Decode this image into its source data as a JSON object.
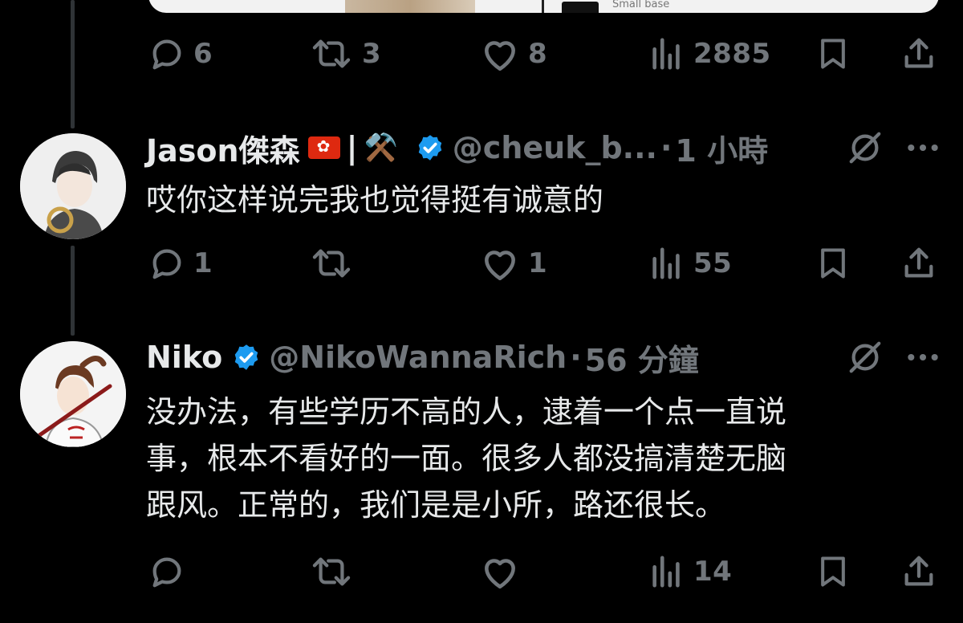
{
  "card": {
    "caption": "Small base"
  },
  "tweets": [
    {
      "actions": {
        "replies": "6",
        "reposts": "3",
        "likes": "8",
        "views": "2885"
      }
    },
    {
      "display_name": "Jason傑森",
      "separator": "|",
      "tools_emoji": "⚒️",
      "handle": "@cheuk_b...",
      "dot": "·",
      "time": "1 小時",
      "text": "哎你这样说完我也觉得挺有诚意的",
      "actions": {
        "replies": "1",
        "reposts": "",
        "likes": "1",
        "views": "55"
      }
    },
    {
      "display_name": "Niko",
      "handle": "@NikoWannaRich",
      "dot": "·",
      "time": "56 分鐘",
      "text_lines": [
        "没办法，有些学历不高的人，逮着一个点一直说",
        "事，根本不看好的一面。很多人都没搞清楚无脑",
        "跟风。正常的，我们是是小所，路还很长。"
      ],
      "actions": {
        "replies": "",
        "reposts": "",
        "likes": "",
        "views": "14"
      }
    }
  ],
  "colors": {
    "background": "#000000",
    "text": "#e7e9ea",
    "muted": "#71767b",
    "verified": "#1d9bf0",
    "thread": "#2f3336"
  },
  "icons": [
    "reply-icon",
    "repost-icon",
    "like-icon",
    "views-icon",
    "bookmark-icon",
    "share-icon",
    "grok-icon",
    "more-icon",
    "verified-badge-icon",
    "hk-flag-icon"
  ]
}
